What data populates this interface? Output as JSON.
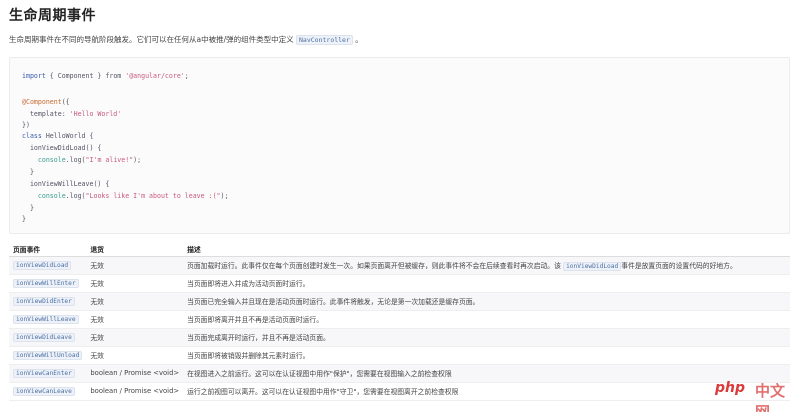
{
  "title": "生命周期事件",
  "intro": {
    "text": "生命周期事件在不同的导航阶段触发。它们可以在任何从a中被推/弹的组件类型中定义",
    "code": "NavController",
    "end": "。"
  },
  "code_lines": [
    {
      "parts": [
        {
          "c": "kw",
          "t": "import"
        },
        {
          "c": "",
          "t": " { Component } from "
        },
        {
          "c": "str",
          "t": "'@angular/core'"
        },
        {
          "c": "",
          "t": ";"
        }
      ]
    },
    {
      "parts": [
        {
          "c": "dec",
          "t": "@Component"
        },
        {
          "c": "",
          "t": "({"
        }
      ]
    },
    {
      "parts": [
        {
          "c": "",
          "t": "  template: "
        },
        {
          "c": "str",
          "t": "'Hello World'"
        }
      ]
    },
    {
      "parts": [
        {
          "c": "",
          "t": "})"
        }
      ]
    },
    {
      "parts": [
        {
          "c": "kw",
          "t": "class"
        },
        {
          "c": "",
          "t": " HelloWorld {"
        }
      ]
    },
    {
      "parts": [
        {
          "c": "",
          "t": "  ionViewDidLoad() {"
        }
      ]
    },
    {
      "parts": [
        {
          "c": "fn",
          "t": "    console"
        },
        {
          "c": "",
          "t": ".log("
        },
        {
          "c": "str",
          "t": "\"I'm alive!\""
        },
        {
          "c": "",
          "t": ");"
        }
      ]
    },
    {
      "parts": [
        {
          "c": "",
          "t": "  }"
        }
      ]
    },
    {
      "parts": [
        {
          "c": "",
          "t": "  ionViewWillLeave() {"
        }
      ]
    },
    {
      "parts": [
        {
          "c": "fn",
          "t": "    console"
        },
        {
          "c": "",
          "t": ".log("
        },
        {
          "c": "str",
          "t": "\"Looks like I'm about to leave :(\""
        },
        {
          "c": "",
          "t": ");"
        }
      ]
    },
    {
      "parts": [
        {
          "c": "",
          "t": "  }"
        }
      ]
    },
    {
      "parts": [
        {
          "c": "",
          "t": "}"
        }
      ]
    }
  ],
  "table": {
    "headers": [
      "页面事件",
      "退货",
      "描述"
    ],
    "rows": [
      {
        "event": "ionViewDidLoad",
        "ret": "无效",
        "desc": "页面加载时运行。此事件仅在每个页面创建时发生一次。如果页面离开但被缓存，则此事件将不会在后续查看时再次启动。该",
        "desc_code": "ionViewDidLoad",
        "desc_end": "事件是放置页面的设置代码的好地方。"
      },
      {
        "event": "ionViewWillEnter",
        "ret": "无效",
        "desc": "当页面即将进入并成为活动页面时运行。"
      },
      {
        "event": "ionViewDidEnter",
        "ret": "无效",
        "desc": "当页面已完全输入并且现在是活动页面时运行。此事件将触发，无论是第一次加载还是缓存页面。"
      },
      {
        "event": "ionViewWillLeave",
        "ret": "无效",
        "desc": "当页面即将离开并且不再是活动页面时运行。"
      },
      {
        "event": "ionViewDidLeave",
        "ret": "无效",
        "desc": "当页面完成离开时运行，并且不再是活动页面。"
      },
      {
        "event": "ionViewWillUnload",
        "ret": "无效",
        "desc": "当页面即将被销毁并删除其元素时运行。"
      },
      {
        "event": "ionViewCanEnter",
        "ret": "boolean / Promise <void>",
        "desc": "在视图进入之前运行。这可以在认证视图中用作\"保护\"，您需要在视图输入之前检查权限"
      },
      {
        "event": "ionViewCanLeave",
        "ret": "boolean / Promise <void>",
        "desc": "运行之前视图可以离开。这可以在认证视图中用作\"守卫\"，您需要在视图离开之前检查权限"
      }
    ]
  },
  "watermark": {
    "brand": "php",
    "suffix": "中文网"
  }
}
